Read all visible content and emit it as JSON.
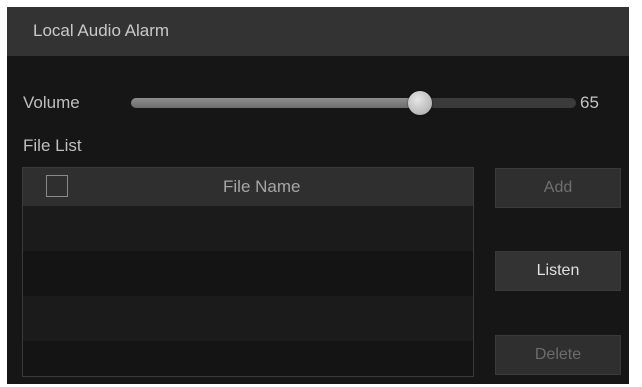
{
  "dialog": {
    "title": "Local Audio Alarm"
  },
  "volume": {
    "label": "Volume",
    "value": 65,
    "value_text": "65",
    "min": 0,
    "max": 100
  },
  "file_list": {
    "label": "File List",
    "columns": [
      "File Name"
    ],
    "rows": [],
    "select_all_checked": false
  },
  "buttons": {
    "add": "Add",
    "listen": "Listen",
    "delete": "Delete"
  },
  "colors": {
    "background": "#161616",
    "titlebar": "#333333",
    "text": "#bfbfbf",
    "button": "#2f2f2f"
  },
  "icons": {
    "slider_thumb": "slider-thumb-icon",
    "checkbox": "checkbox-icon"
  }
}
